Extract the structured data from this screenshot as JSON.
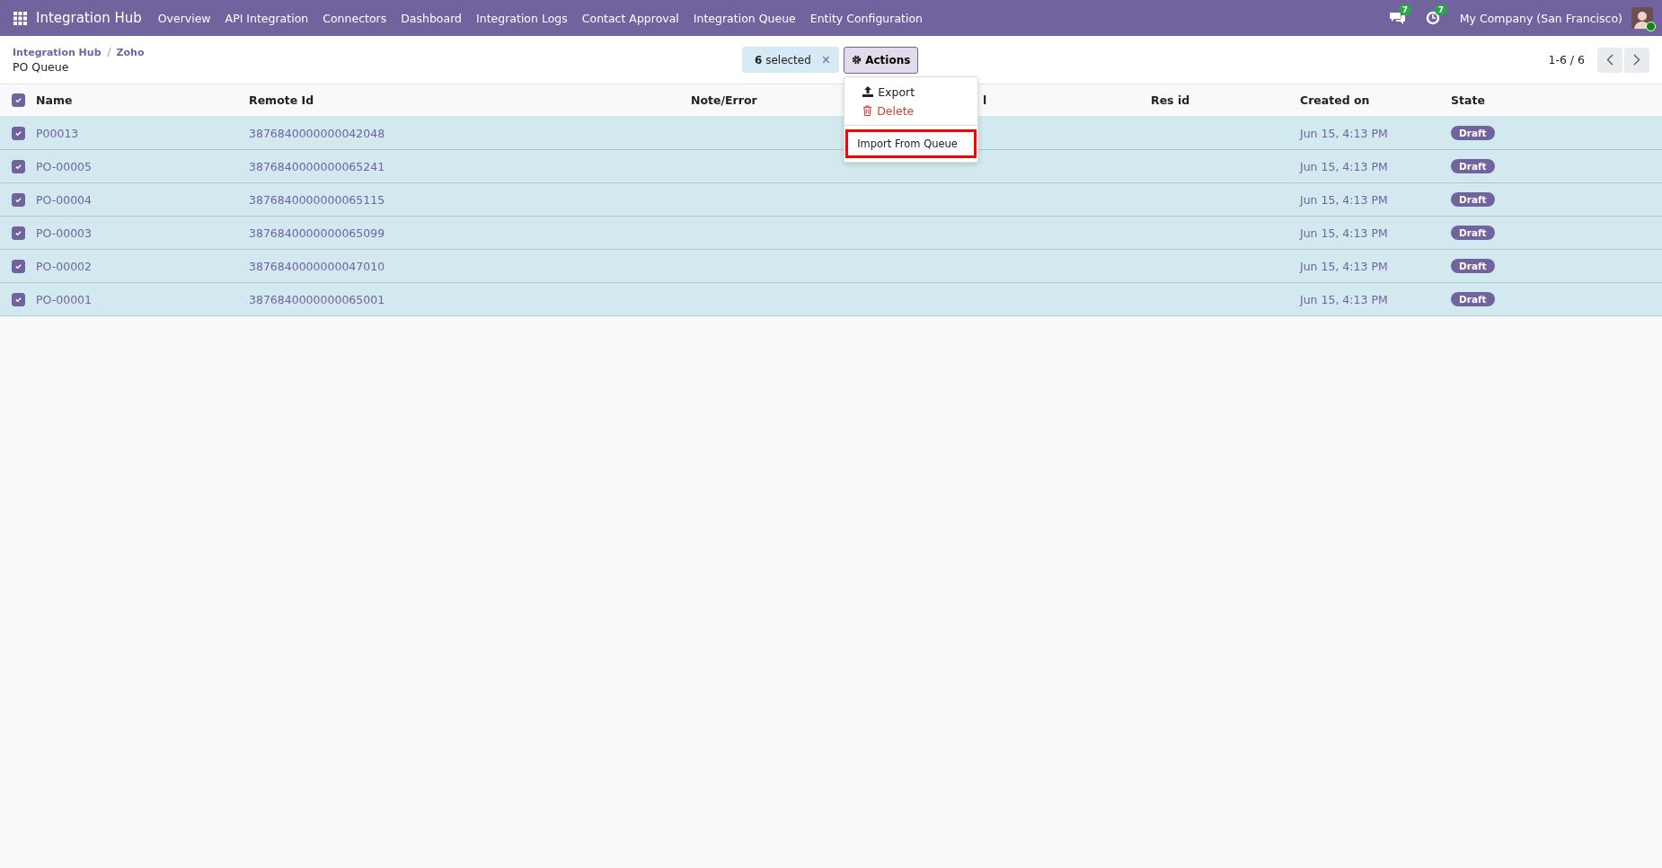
{
  "navbar": {
    "app_name": "Integration Hub",
    "menu": [
      "Overview",
      "API Integration",
      "Connectors",
      "Dashboard",
      "Integration Logs",
      "Contact Approval",
      "Integration Queue",
      "Entity Configuration"
    ],
    "messages_count": "7",
    "activities_count": "7",
    "company": "My Company (San Francisco)",
    "user_online": true
  },
  "breadcrumb": {
    "items": [
      "Integration Hub",
      "Zoho"
    ],
    "title": "PO Queue"
  },
  "selection": {
    "count": "6",
    "label": "selected",
    "clear": "×"
  },
  "actions_button": "Actions",
  "actions_menu": [
    {
      "kind": "export",
      "label": "Export",
      "highlighted": false
    },
    {
      "kind": "delete",
      "label": "Delete",
      "highlighted": false
    },
    {
      "kind": "divider"
    },
    {
      "kind": "plain",
      "label": "Import From Queue",
      "highlighted": true
    }
  ],
  "pager": "1-6 / 6",
  "table": {
    "all_checked": true,
    "columns": [
      "Name",
      "Remote Id",
      "Note/Error",
      "l",
      "Res id",
      "Created on",
      "State"
    ],
    "rows": [
      {
        "selected": true,
        "name": "P00013",
        "remote_id": "3876840000000042048",
        "created_on": "Jun 15, 4:13 PM",
        "state": "Draft"
      },
      {
        "selected": true,
        "name": "PO-00005",
        "remote_id": "3876840000000065241",
        "created_on": "Jun 15, 4:13 PM",
        "state": "Draft"
      },
      {
        "selected": true,
        "name": "PO-00004",
        "remote_id": "3876840000000065115",
        "created_on": "Jun 15, 4:13 PM",
        "state": "Draft"
      },
      {
        "selected": true,
        "name": "PO-00003",
        "remote_id": "3876840000000065099",
        "created_on": "Jun 15, 4:13 PM",
        "state": "Draft"
      },
      {
        "selected": true,
        "name": "PO-00002",
        "remote_id": "3876840000000047010",
        "created_on": "Jun 15, 4:13 PM",
        "state": "Draft"
      },
      {
        "selected": true,
        "name": "PO-00001",
        "remote_id": "3876840000000065001",
        "created_on": "Jun 15, 4:13 PM",
        "state": "Draft"
      }
    ]
  }
}
